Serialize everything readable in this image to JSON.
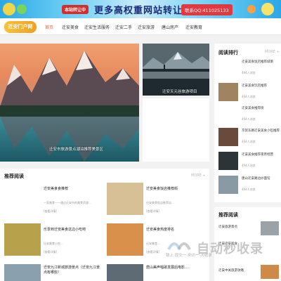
{
  "banner": {
    "sale_label": "本站转让中",
    "headline": "更多高权重网站转让",
    "contact": "联系QQ:411025133"
  },
  "nav": {
    "logo_text": "迁安门户网",
    "items": [
      "首页",
      "迁安美食",
      "迁安生活服务",
      "迁安二手",
      "迁安旅游",
      "唐山房产",
      "迁安教育"
    ],
    "active_index": 0
  },
  "hero": {
    "main_caption": "迁安市旅游景点湖泊推荐美景区",
    "side_caption": "迁安天元谷旅游项目"
  },
  "rank": {
    "title": "阅读排行",
    "more": "MORE +",
    "items": [
      {
        "title": "迁安美食饭店推荐城南",
        "views": "494人浏览"
      },
      {
        "title": "迁安美食饮店推荐",
        "views": "494人浏览"
      },
      {
        "title": "迁安美食推荐街",
        "views": "494人浏览"
      },
      {
        "title": "京贸东路迁安美食小吃推荐",
        "views": "494人浏览"
      },
      {
        "title": "迁安美食推荐夜宵经营",
        "views": "494人浏览"
      },
      {
        "title": "唐山迁安路边炒面馆",
        "views": "494人浏览"
      }
    ]
  },
  "reco": {
    "title": "推荐阅读",
    "more": "MORE +",
    "items": [
      {
        "title": "迁安美食食推荐",
        "desc": "一家美食——通过迁安市的美食资源…",
        "link": "[查看详情]"
      },
      {
        "title": "迁安美食饭店推荐街",
        "desc": "迁安美食饭店推荐店…",
        "link": "[查看详情]"
      },
      {
        "title": "乐享到迁安美食这边小吃吧",
        "desc": "迁安美食小吃…",
        "link": "[查看详情]"
      },
      {
        "title": "迁安美食热度排名",
        "desc": "迁安美食…",
        "link": "[查看详情]"
      },
      {
        "title": "迁安九江新城旅游景点（迁安九江景点有哪些）",
        "desc": "",
        "link": ""
      },
      {
        "title": "唐山美声唱歌发展后电影…",
        "desc": "",
        "link": ""
      }
    ]
  },
  "reco2": {
    "title": "推荐阅读",
    "items": [
      "迁安旅游景点",
      "迁安迁安美食",
      "迁安中关旅游攻略"
    ]
  },
  "watermark": {
    "text": "自动秒收录",
    "sub": "致上 提交一·来访一·次收录"
  }
}
